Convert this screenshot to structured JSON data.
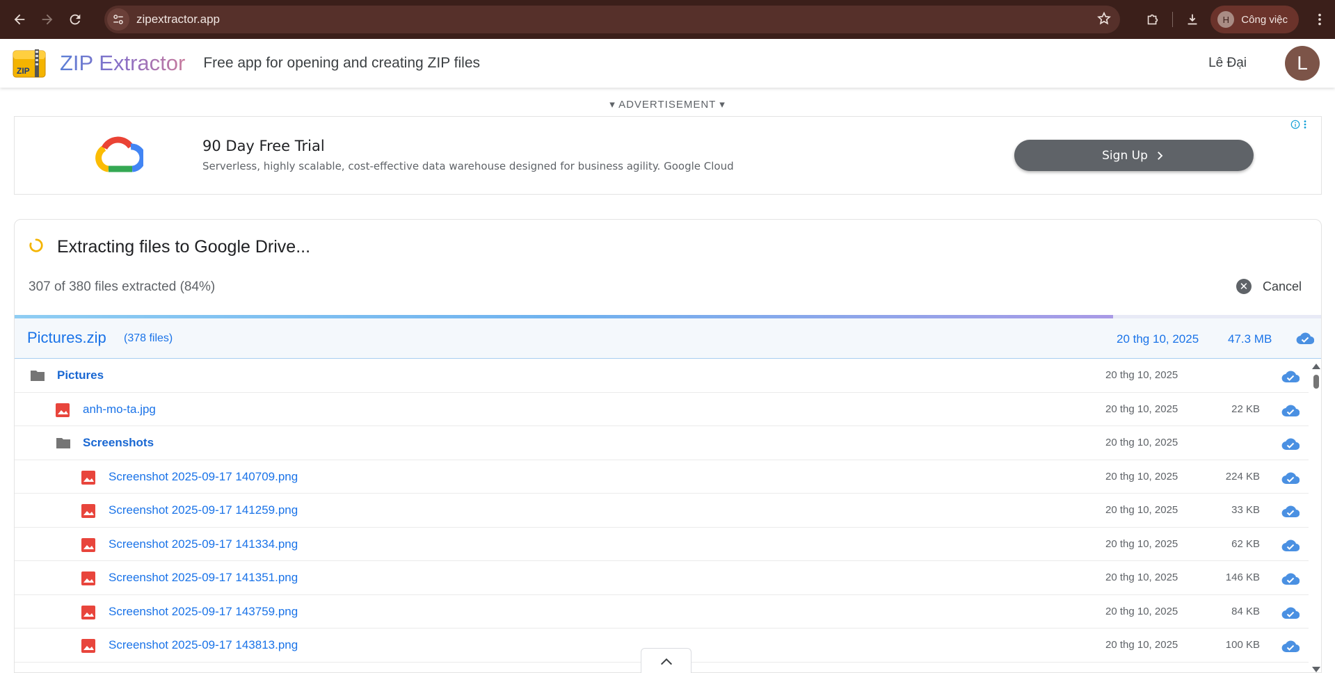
{
  "browser": {
    "url": "zipextractor.app",
    "profile_initial": "H",
    "profile_label": "Công việc"
  },
  "header": {
    "brand": "ZIP Extractor",
    "logo_text": "ZIP",
    "tagline": "Free app for opening and creating ZIP files",
    "user_name": "Lê Đại",
    "avatar_initial": "L"
  },
  "ad": {
    "label": "▾ ADVERTISEMENT ▾",
    "title": "90 Day Free Trial",
    "description": "Serverless, highly scalable, cost-effective data warehouse designed for business agility. Google Cloud",
    "cta": "Sign Up"
  },
  "extraction": {
    "title": "Extracting files to Google Drive...",
    "progress_text": "307 of 380 files extracted (84%)",
    "progress_fraction": 0.84,
    "cancel_label": "Cancel"
  },
  "archive": {
    "name": "Pictures.zip",
    "count": "(378 files)",
    "date": "20 thg 10, 2025",
    "size": "47.3 MB"
  },
  "files": [
    {
      "name": "Pictures",
      "type": "folder",
      "depth": 0,
      "date": "20 thg 10, 2025",
      "size": ""
    },
    {
      "name": "anh-mo-ta.jpg",
      "type": "image",
      "depth": 1,
      "date": "20 thg 10, 2025",
      "size": "22 KB"
    },
    {
      "name": "Screenshots",
      "type": "folder",
      "depth": 1,
      "date": "20 thg 10, 2025",
      "size": ""
    },
    {
      "name": "Screenshot 2025-09-17 140709.png",
      "type": "image",
      "depth": 2,
      "date": "20 thg 10, 2025",
      "size": "224 KB"
    },
    {
      "name": "Screenshot 2025-09-17 141259.png",
      "type": "image",
      "depth": 2,
      "date": "20 thg 10, 2025",
      "size": "33 KB"
    },
    {
      "name": "Screenshot 2025-09-17 141334.png",
      "type": "image",
      "depth": 2,
      "date": "20 thg 10, 2025",
      "size": "62 KB"
    },
    {
      "name": "Screenshot 2025-09-17 141351.png",
      "type": "image",
      "depth": 2,
      "date": "20 thg 10, 2025",
      "size": "146 KB"
    },
    {
      "name": "Screenshot 2025-09-17 143759.png",
      "type": "image",
      "depth": 2,
      "date": "20 thg 10, 2025",
      "size": "84 KB"
    },
    {
      "name": "Screenshot 2025-09-17 143813.png",
      "type": "image",
      "depth": 2,
      "date": "20 thg 10, 2025",
      "size": "100 KB"
    }
  ],
  "colors": {
    "chrome_bg": "#3b1f1a",
    "link_blue": "#1a73e8",
    "image_icon_red": "#e8453c",
    "folder_gray": "#757575",
    "cloud_blue": "#4a90e2"
  },
  "icons": {
    "back": "arrow-left-icon",
    "forward": "arrow-right-icon",
    "reload": "reload-icon",
    "site_settings": "tune-icon",
    "bookmark": "star-icon",
    "extensions": "puzzle-icon",
    "downloads": "download-icon",
    "menu": "kebab-menu-icon",
    "spinner": "spinner-icon",
    "cancel": "close-circle-icon",
    "cloud": "cloud-done-icon",
    "folder": "folder-icon",
    "image": "image-icon",
    "collapse": "chevron-up-icon"
  }
}
